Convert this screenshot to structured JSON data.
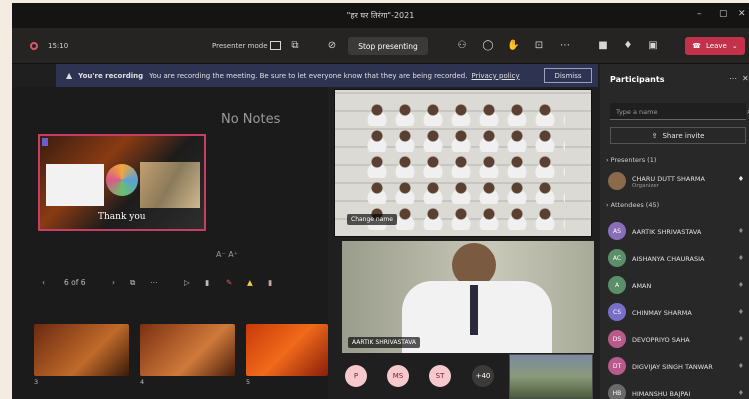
{
  "window": {
    "title": "\"हर घर तिरंगा\"-2021"
  },
  "toolbar": {
    "timer": "15:10",
    "presenter_mode_label": "Presenter mode",
    "stop_presenting_label": "Stop presenting",
    "leave_label": "Leave"
  },
  "banner": {
    "strong": "You're recording",
    "message": "You are recording the meeting. Be sure to let everyone know that they are being recorded.",
    "link": "Privacy policy",
    "dismiss_label": "Dismiss"
  },
  "presenter": {
    "no_notes": "No Notes",
    "slide_caption": "Thank you",
    "font_size_controls": "A⁻ A⁺",
    "slide_counter": "6 of 6",
    "thumbnails": [
      {
        "num": "3"
      },
      {
        "num": "4"
      },
      {
        "num": "5"
      }
    ]
  },
  "videos": {
    "room_label": "Change name",
    "speaker_label": "AARTIK SHRIVASTAVA",
    "avatars": [
      "P",
      "MS",
      "ST"
    ],
    "overflow": "+40"
  },
  "sidebar": {
    "title": "Participants",
    "search_placeholder": "Type a name",
    "share_invite_label": "Share invite",
    "presenters_header": "Presenters (1)",
    "presenter": {
      "initials": "",
      "name": "CHARU DUTT SHARMA",
      "role": "Organizer"
    },
    "attendees_header": "Attendees (45)",
    "attendees": [
      {
        "initials": "AS",
        "name": "AARTIK SHRIVASTAVA",
        "color": "#8a6fb8"
      },
      {
        "initials": "AC",
        "name": "AISHANYA CHAURASIA",
        "color": "#5a8f6a"
      },
      {
        "initials": "A",
        "name": "AMAN",
        "color": "#5a8f6a"
      },
      {
        "initials": "CS",
        "name": "CHINMAY SHARMA",
        "color": "#7a6fc8"
      },
      {
        "initials": "DS",
        "name": "DEVOPRIYO SAHA",
        "color": "#b85a8a"
      },
      {
        "initials": "DT",
        "name": "DIGVIJAY SINGH TANWAR",
        "color": "#b85a8a"
      },
      {
        "initials": "HB",
        "name": "HIMANSHU BAJPAI",
        "color": "#6a6a6a"
      }
    ]
  },
  "colors": {
    "leave": "#c4314b",
    "banner": "#2d3350",
    "slide_border": "#c63f62"
  }
}
